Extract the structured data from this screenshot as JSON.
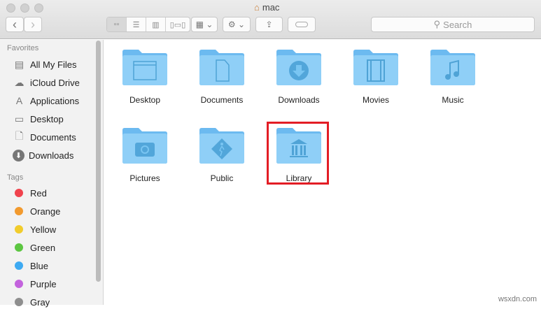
{
  "window": {
    "title": "mac"
  },
  "toolbar": {
    "back": "‹",
    "forward": "›",
    "search_placeholder": "Search"
  },
  "sidebar": {
    "favorites_header": "Favorites",
    "favorites": [
      {
        "label": "All My Files"
      },
      {
        "label": "iCloud Drive"
      },
      {
        "label": "Applications"
      },
      {
        "label": "Desktop"
      },
      {
        "label": "Documents"
      },
      {
        "label": "Downloads"
      }
    ],
    "tags_header": "Tags",
    "tags": [
      {
        "label": "Red",
        "color": "#f0434d"
      },
      {
        "label": "Orange",
        "color": "#f29a2e"
      },
      {
        "label": "Yellow",
        "color": "#f1cc2c"
      },
      {
        "label": "Green",
        "color": "#5cc641"
      },
      {
        "label": "Blue",
        "color": "#3eaaf2"
      },
      {
        "label": "Purple",
        "color": "#c363dd"
      },
      {
        "label": "Gray",
        "color": "#8e8e8e"
      }
    ]
  },
  "folders": [
    {
      "label": "Desktop"
    },
    {
      "label": "Documents"
    },
    {
      "label": "Downloads"
    },
    {
      "label": "Movies"
    },
    {
      "label": "Music"
    },
    {
      "label": "Pictures"
    },
    {
      "label": "Public"
    },
    {
      "label": "Library"
    }
  ],
  "highlight_color": "#e31d25",
  "watermark": "wsxdn.com"
}
